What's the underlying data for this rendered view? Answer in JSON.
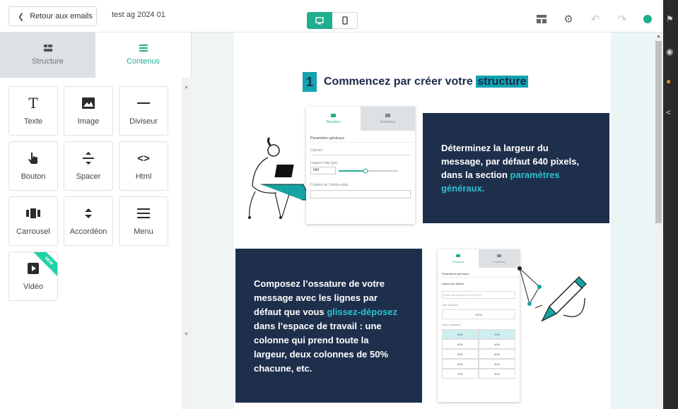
{
  "header": {
    "back_label": "Retour aux emails",
    "doc_title": "test ag 2024 01"
  },
  "sidebar": {
    "tabs": [
      {
        "label": "Structure",
        "icon": "structure-icon",
        "active": false
      },
      {
        "label": "Contenus",
        "icon": "contents-icon",
        "active": true
      }
    ],
    "blocks": [
      {
        "label": "Texte",
        "icon": "text-icon"
      },
      {
        "label": "Image",
        "icon": "image-icon"
      },
      {
        "label": "Diviseur",
        "icon": "divider-icon"
      },
      {
        "label": "Bouton",
        "icon": "button-hand-icon"
      },
      {
        "label": "Spacer",
        "icon": "spacer-icon"
      },
      {
        "label": "Html",
        "icon": "code-icon"
      },
      {
        "label": "Carrousel",
        "icon": "carousel-icon"
      },
      {
        "label": "Accordéon",
        "icon": "accordion-icon"
      },
      {
        "label": "Menu",
        "icon": "menu-icon"
      },
      {
        "label": "Vidéo",
        "icon": "video-icon",
        "badge": "NEW"
      }
    ]
  },
  "email": {
    "step1": {
      "number": "1",
      "heading_prefix": "Commencez par créer votre",
      "heading_highlight": "structure"
    },
    "card1": {
      "text": "Déterminez la largeur du message, par défaut 640 pixels, dans la section",
      "highlight": "paramètres généraux."
    },
    "card2": {
      "text_before": "Composez l’ossature de votre message avec les lignes par défaut que vous",
      "highlight": "glissez-déposez",
      "text_after": "dans l’espace de travail : une colonne qui prend toute la largeur, deux colonnes de 50% chacune, etc."
    },
    "mock1": {
      "tab_structure": "Structure",
      "tab_contents": "Contenus",
      "section": "Paramètres généraux",
      "canvas": "Canvas",
      "width_label": "Largeur max (px)",
      "width_value": "640",
      "bg_color_label": "Couleur de l’arrière-plan"
    },
    "mock2": {
      "tab_structure": "Structure",
      "tab_contents": "Contenus",
      "section": "Paramètres généraux",
      "default_lines": "Lignes par défaut",
      "search_placeholder": "Entrer une structure, ex: 50-25-25",
      "one_col": "Une colonne",
      "full": "100%",
      "two_cols": "Deux colonnes",
      "rows": [
        [
          "30%",
          "70%"
        ],
        [
          "60%",
          "40%"
        ],
        [
          "50%",
          "50%"
        ],
        [
          "60%",
          "40%"
        ],
        [
          "70%",
          "30%"
        ]
      ]
    }
  },
  "colors": {
    "accent": "#1fae8f",
    "navy": "#1e2f4c",
    "teal": "#14a3b0"
  }
}
